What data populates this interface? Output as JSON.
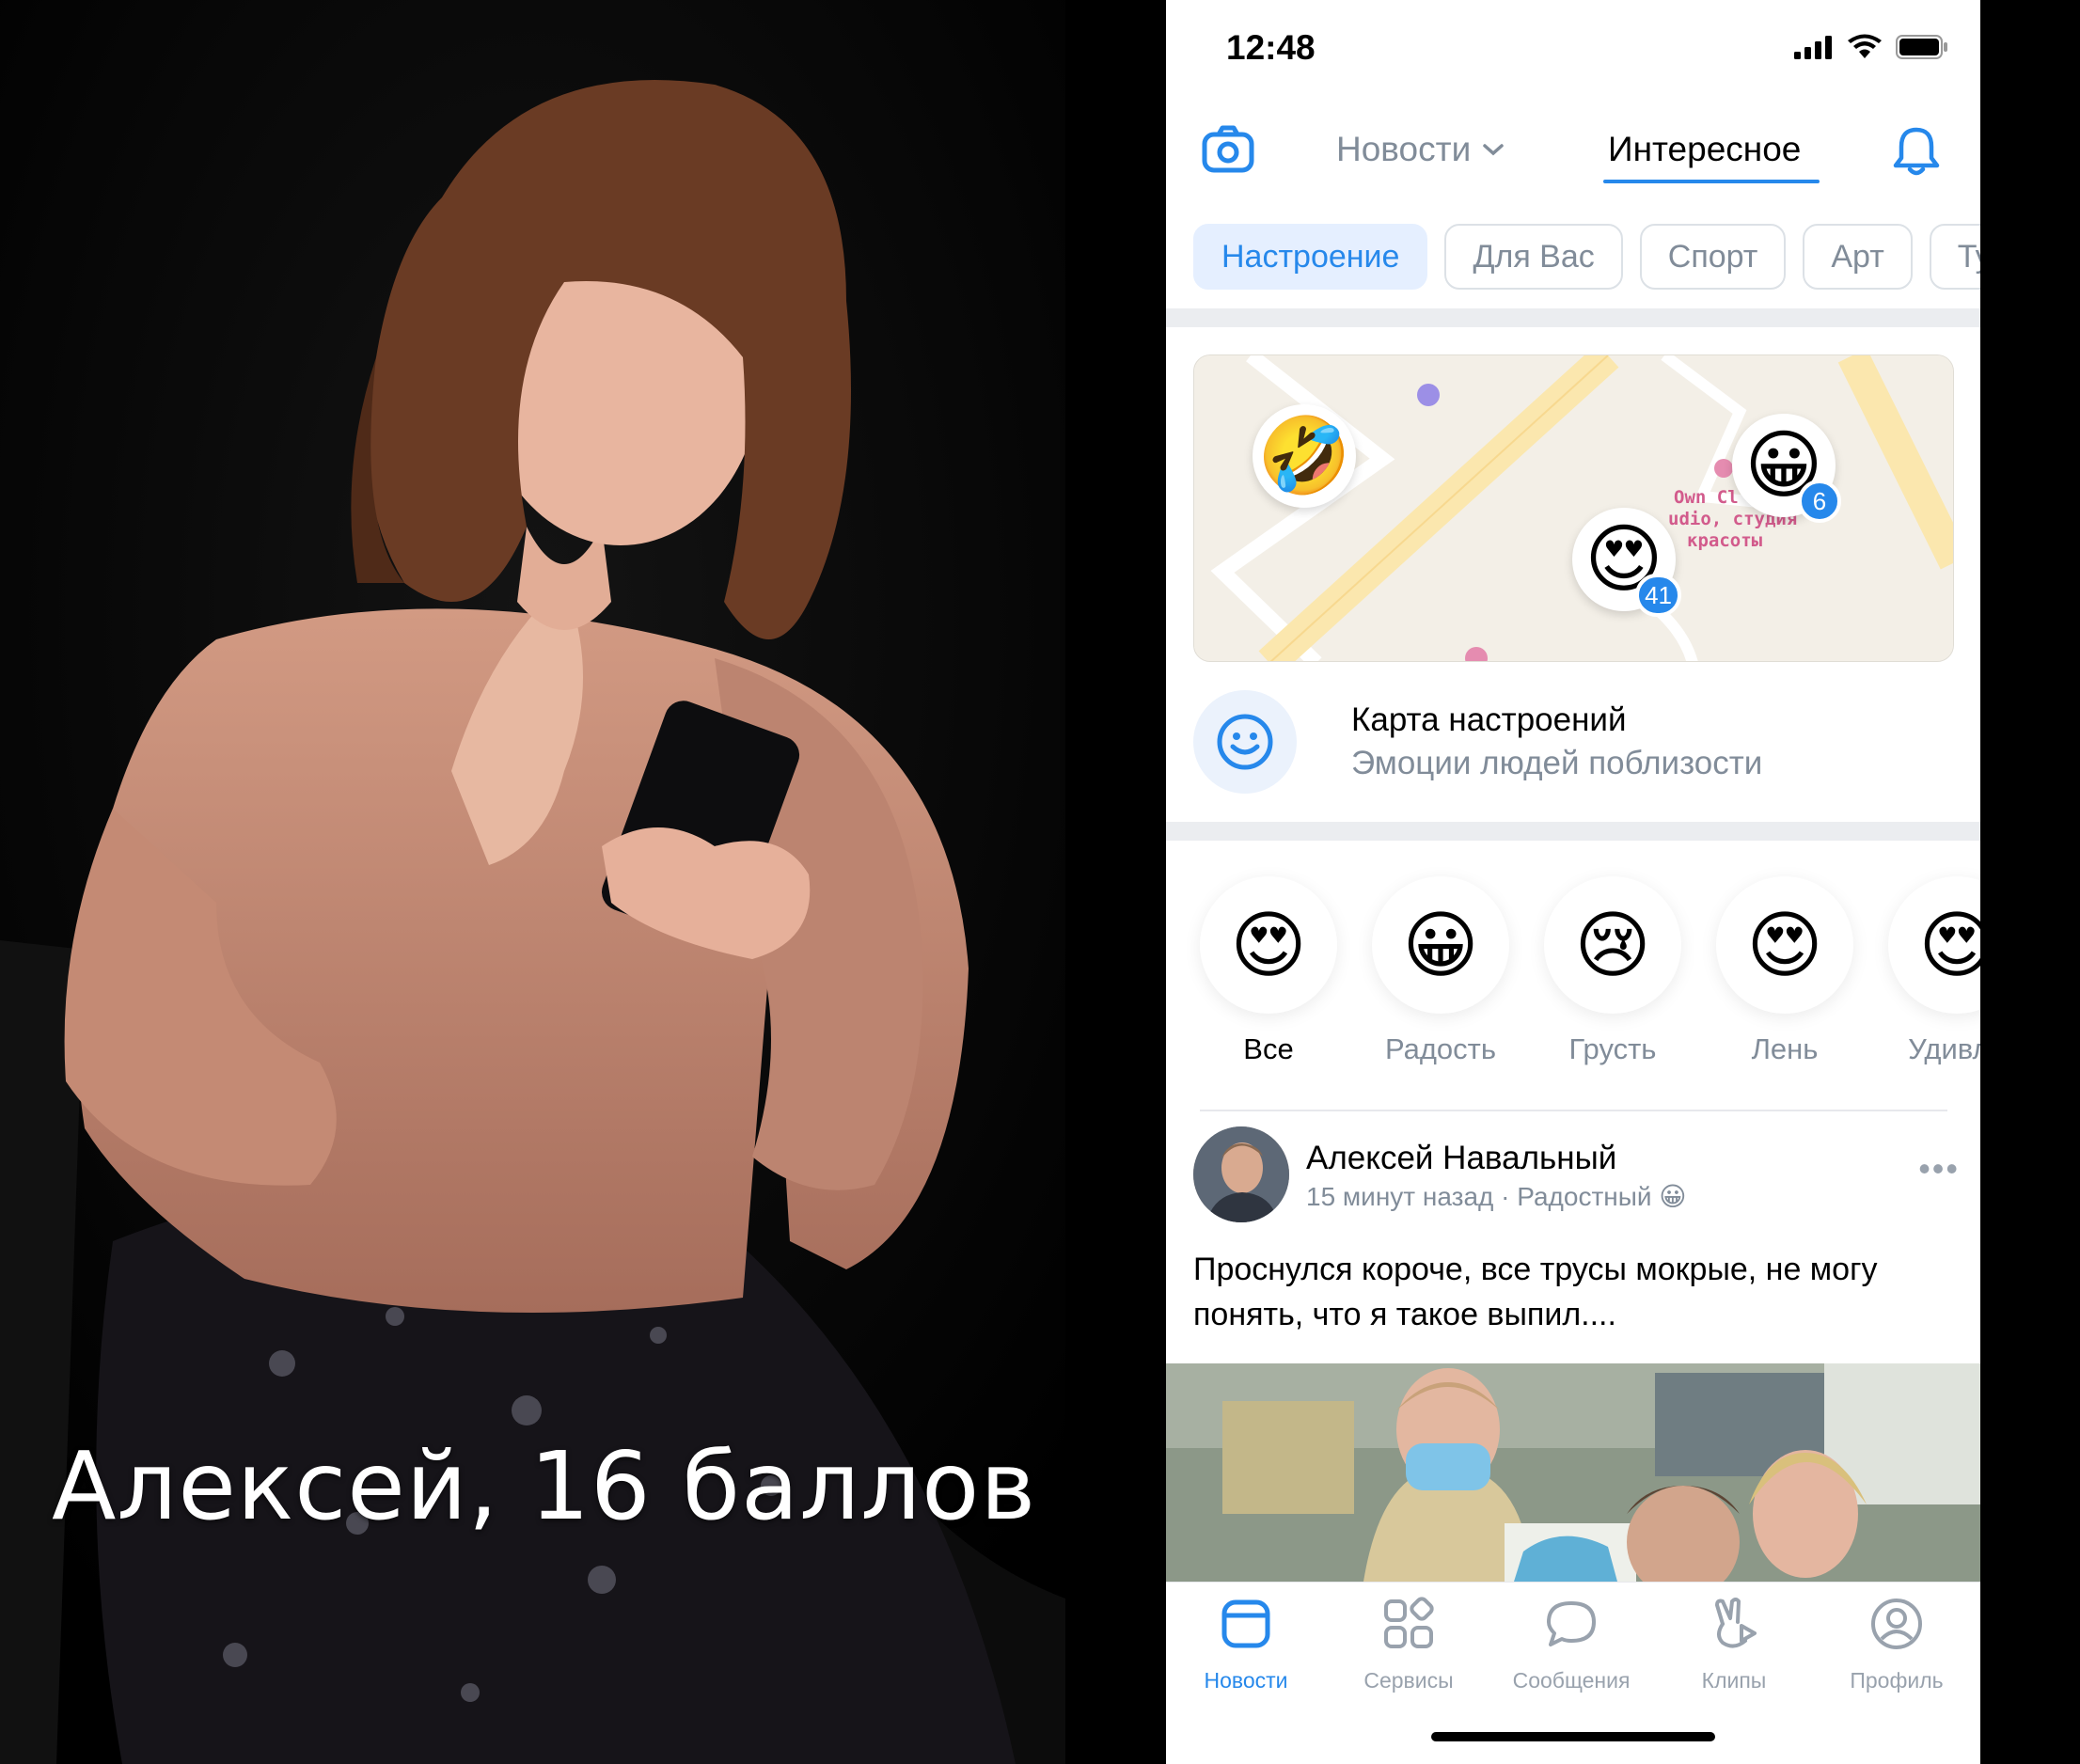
{
  "caption": "Алексей, 16 баллов",
  "status_bar": {
    "time": "12:48"
  },
  "navbar": {
    "camera_icon": "camera-icon",
    "tab_news": "Новости",
    "tab_interesting": "Интересное",
    "bell_icon": "bell-icon"
  },
  "chips": [
    "Настроение",
    "Для Вас",
    "Спорт",
    "Арт",
    "Ту"
  ],
  "map": {
    "poi_name_lines": [
      "Own Cl",
      "udio, студия",
      "красоты"
    ],
    "markers": [
      {
        "emoji": "🤣",
        "count": ""
      },
      {
        "emoji": "😀",
        "count": "6"
      },
      {
        "emoji": "😍",
        "count": "41"
      }
    ]
  },
  "mood_map": {
    "title": "Карта настроений",
    "subtitle": "Эмоции людей поблизости"
  },
  "moods": [
    {
      "emoji": "😍",
      "label": "Все"
    },
    {
      "emoji": "😀",
      "label": "Радость"
    },
    {
      "emoji": "😢",
      "label": "Грусть"
    },
    {
      "emoji": "😍",
      "label": "Лень"
    },
    {
      "emoji": "😍",
      "label": "Удивле"
    }
  ],
  "post": {
    "author": "Алексей Навальный",
    "meta": "15 минут назад · Радостный 😀",
    "text": "Проснулся короче, все трусы мокрые, не могу понять, что я такое выпил...."
  },
  "tabbar": [
    {
      "label": "Новости",
      "icon": "news-icon"
    },
    {
      "label": "Сервисы",
      "icon": "services-icon"
    },
    {
      "label": "Сообщения",
      "icon": "messages-icon"
    },
    {
      "label": "Клипы",
      "icon": "clips-icon"
    },
    {
      "label": "Профиль",
      "icon": "profile-icon"
    }
  ],
  "colors": {
    "accent": "#2688eb",
    "secondary_text": "#818c99",
    "separator": "#ebedf0"
  }
}
